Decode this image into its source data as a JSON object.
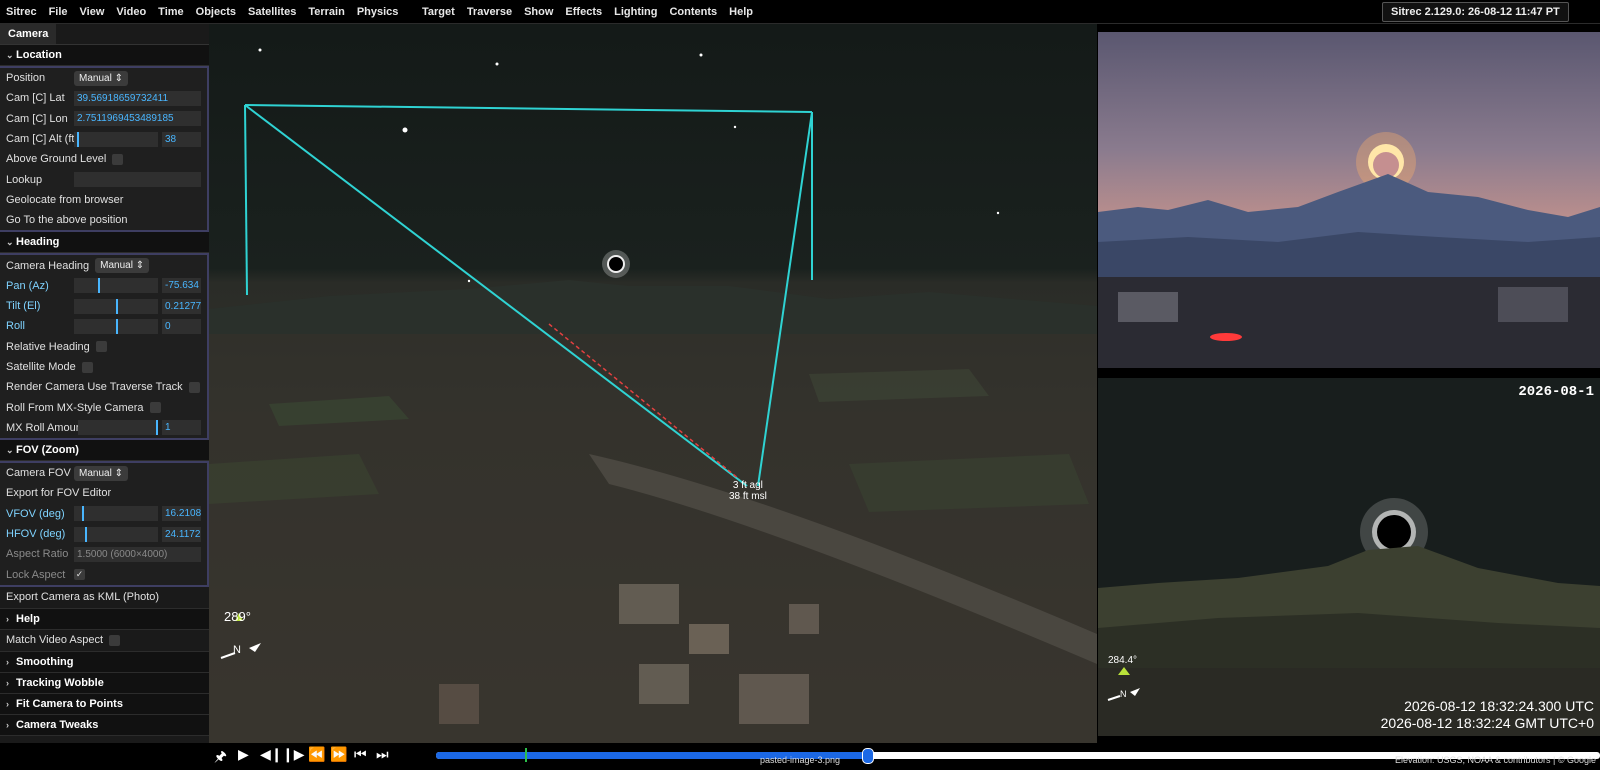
{
  "menu": {
    "left": [
      "Sitrec",
      "File",
      "View",
      "Video",
      "Time",
      "Objects",
      "Satellites",
      "Terrain",
      "Physics"
    ],
    "right": [
      "Target",
      "Traverse",
      "Show",
      "Effects",
      "Lighting",
      "Contents",
      "Help"
    ],
    "version": "Sitrec 2.129.0: 26-08-12 11:47 PT"
  },
  "panel": {
    "tab": "Camera",
    "location": {
      "title": "Location",
      "position_label": "Position",
      "position_value": "Manual",
      "lat_label": "Cam [C] Lat",
      "lat_value": "39.56918659732411",
      "lon_label": "Cam [C] Lon",
      "lon_value": "2.7511969453489185",
      "alt_label": "Cam [C] Alt (ft)",
      "alt_value": "38",
      "alt_level": 0.02,
      "above_ground_label": "Above Ground Level",
      "lookup_label": "Lookup",
      "geolocate_label": "Geolocate from browser",
      "goto_label": "Go To the above position"
    },
    "heading": {
      "title": "Heading",
      "camera_heading_label": "Camera Heading",
      "camera_heading_value": "Manual",
      "pan_label": "Pan (Az)",
      "pan_value": "-75.634",
      "tilt_label": "Tilt (El)",
      "tilt_value": "0.21277",
      "roll_label": "Roll",
      "roll_value": "0",
      "relative_heading_label": "Relative Heading",
      "satellite_mode_label": "Satellite Mode",
      "render_traverse_label": "Render Camera Use Traverse Track",
      "roll_mx_label": "Roll From MX-Style Camera",
      "mx_roll_label": "MX Roll Amount",
      "mx_roll_value": "1"
    },
    "fov": {
      "title": "FOV (Zoom)",
      "camera_fov_label": "Camera FOV",
      "camera_fov_value": "Manual",
      "export_fov_label": "Export for FOV Editor",
      "vfov_label": "VFOV (deg)",
      "vfov_value": "16.2108",
      "hfov_label": "HFOV (deg)",
      "hfov_value": "24.1172",
      "aspect_label": "Aspect Ratio",
      "aspect_value": "1.5000  (6000×4000)",
      "lock_aspect_label": "Lock Aspect"
    },
    "export_kml": "Export Camera as KML (Photo)",
    "help": "Help",
    "match_video_aspect": "Match Video Aspect",
    "smoothing": "Smoothing",
    "tracking_wobble": "Tracking Wobble",
    "fit_camera": "Fit Camera to Points",
    "camera_tweaks": "Camera Tweaks"
  },
  "view": {
    "compass_deg": "289°",
    "compass_n": "N",
    "agl_line1": "3 ft agl",
    "agl_line2": "38 ft msl"
  },
  "lookview": {
    "compass_deg": "284.4°",
    "compass_n": "N",
    "date_partial": "2026-08-1",
    "time_utc": "2026-08-12 18:32:24.300 UTC",
    "time_gmt": "2026-08-12 18:32:24 GMT UTC+0"
  },
  "bottom": {
    "filename": "pasted-image-3.png",
    "attribution": "Elevation: USGS, NOAA & contributors | © Google",
    "progress": 0.37
  },
  "colors": {
    "accent": "#49b6ff",
    "frustum": "#2fd3d3",
    "timeline": "#1b68e5"
  }
}
